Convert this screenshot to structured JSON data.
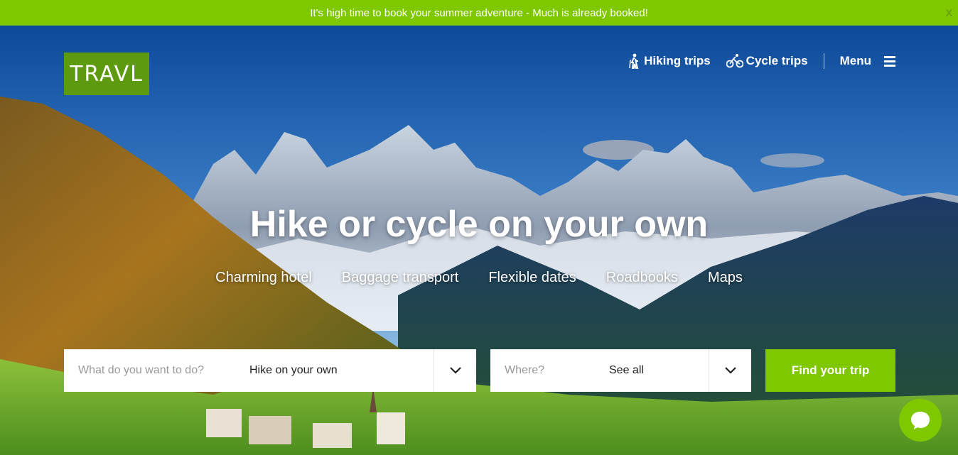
{
  "banner": {
    "text": "It's high time to book your summer adventure - Much is already booked!",
    "close": "X"
  },
  "logo": {
    "text": "TRAVL"
  },
  "nav": {
    "hiking": {
      "label": "Hiking trips",
      "icon": "hiker-icon"
    },
    "cycle": {
      "label": "Cycle trips",
      "icon": "bicycle-icon"
    },
    "menu": {
      "label": "Menu",
      "icon": "hamburger-icon"
    }
  },
  "hero": {
    "headline": "Hike or cycle on your own",
    "features": [
      "Charming hotel",
      "Baggage transport",
      "Flexible dates",
      "Roadbooks",
      "Maps"
    ]
  },
  "search": {
    "activity": {
      "placeholder": "What do you want to do?",
      "value": "Hike on your own"
    },
    "where": {
      "placeholder": "Where?",
      "value": "See all"
    },
    "button": "Find your trip"
  },
  "chat": {
    "icon": "chat-bubble-icon"
  },
  "colors": {
    "accent": "#7fc800",
    "logo_bg": "#5e9a10"
  }
}
